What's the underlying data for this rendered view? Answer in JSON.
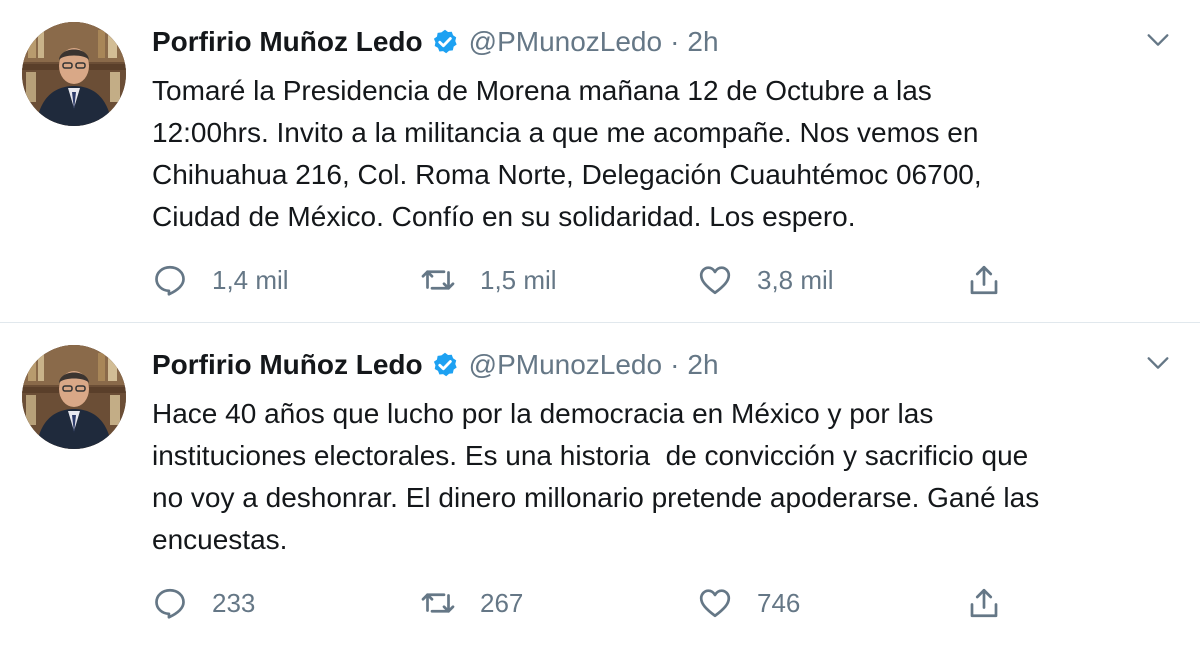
{
  "tweets": [
    {
      "author": {
        "name": "Porfirio Muñoz Ledo",
        "handle": "@PMunozLedo",
        "verified": true
      },
      "separator": "·",
      "time": "2h",
      "text": "Tomaré la Presidencia de Morena mañana 12 de Octubre a las\n12:00hrs. Invito a la militancia a que me acompañe. Nos vemos en\nChihuahua 216, Col. Roma Norte, Delegación Cuauhtémoc 06700,\nCiudad de México. Confío en su solidaridad. Los espero.",
      "replies": "1,4 mil",
      "retweets": "1,5 mil",
      "likes": "3,8 mil"
    },
    {
      "author": {
        "name": "Porfirio Muñoz Ledo",
        "handle": "@PMunozLedo",
        "verified": true
      },
      "separator": "·",
      "time": "2h",
      "text": "Hace 40 años que lucho por la democracia en México y por las\ninstituciones electorales. Es una historia  de convicción y sacrificio que\nno voy a deshonrar. El dinero millonario pretende apoderarse. Gané las\nencuestas.",
      "replies": "233",
      "retweets": "267",
      "likes": "746"
    }
  ],
  "colors": {
    "text": "#14171a",
    "secondary": "#657786",
    "verified": "#1da1f2",
    "border": "#e1e8ed"
  },
  "icons": {
    "reply": "reply-icon",
    "retweet": "retweet-icon",
    "like": "like-icon",
    "share": "share-icon",
    "menu": "chevron-down-icon",
    "verified": "verified-badge-icon"
  }
}
